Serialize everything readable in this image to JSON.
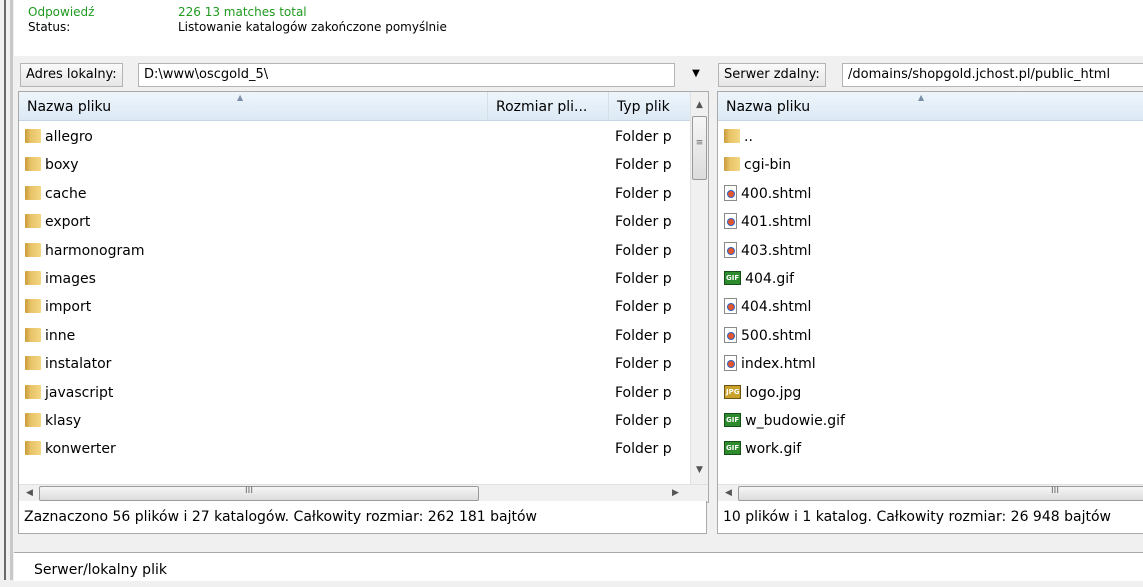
{
  "log": {
    "line1_key": "Odpowiedź",
    "line1_value": "226 13 matches total",
    "line2_key": "Status:",
    "line2_value": "Listowanie katalogów zakończone pomyślnie"
  },
  "local": {
    "address_label": "Adres lokalny:",
    "address_value": "D:\\www\\oscgold_5\\",
    "columns": [
      "Nazwa pliku",
      "Rozmiar pli...",
      "Typ plik"
    ],
    "items": [
      {
        "name": "allegro",
        "type": "Folder p"
      },
      {
        "name": "boxy",
        "type": "Folder p"
      },
      {
        "name": "cache",
        "type": "Folder p"
      },
      {
        "name": "export",
        "type": "Folder p"
      },
      {
        "name": "harmonogram",
        "type": "Folder p"
      },
      {
        "name": "images",
        "type": "Folder p"
      },
      {
        "name": "import",
        "type": "Folder p"
      },
      {
        "name": "inne",
        "type": "Folder p"
      },
      {
        "name": "instalator",
        "type": "Folder p"
      },
      {
        "name": "javascript",
        "type": "Folder p"
      },
      {
        "name": "klasy",
        "type": "Folder p"
      },
      {
        "name": "konwerter",
        "type": "Folder p"
      }
    ],
    "status": "Zaznaczono 56 plików i 27 katalogów. Całkowity rozmiar: 262 181 bajtów"
  },
  "remote": {
    "address_label": "Serwer zdalny:",
    "address_value": "/domains/shopgold.jchost.pl/public_html",
    "columns": [
      "Nazwa pliku"
    ],
    "items": [
      {
        "name": "..",
        "icon": "folder-icon"
      },
      {
        "name": "cgi-bin",
        "icon": "folder-icon"
      },
      {
        "name": "400.shtml",
        "icon": "html-file-icon"
      },
      {
        "name": "401.shtml",
        "icon": "html-file-icon"
      },
      {
        "name": "403.shtml",
        "icon": "html-file-icon"
      },
      {
        "name": "404.gif",
        "icon": "gif-file-icon"
      },
      {
        "name": "404.shtml",
        "icon": "html-file-icon"
      },
      {
        "name": "500.shtml",
        "icon": "html-file-icon"
      },
      {
        "name": "index.html",
        "icon": "html-file-icon"
      },
      {
        "name": "logo.jpg",
        "icon": "jpg-file-icon"
      },
      {
        "name": "w_budowie.gif",
        "icon": "gif-file-icon"
      },
      {
        "name": "work.gif",
        "icon": "gif-file-icon"
      }
    ],
    "status": "10 plików i 1 katalog. Całkowity rozmiar: 26 948 bajtów"
  },
  "icons": {
    "gif_text": "GIF",
    "jpg_text": "JPG"
  },
  "queue": {
    "label": "Serwer/lokalny plik"
  }
}
